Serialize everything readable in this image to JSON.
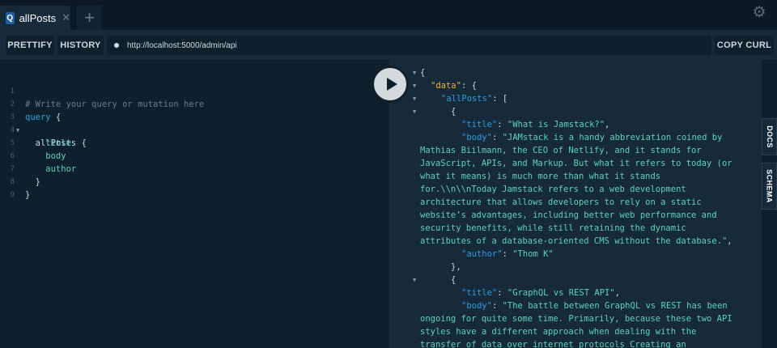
{
  "tabbar": {
    "tab": {
      "icon": "Q",
      "title": "allPosts",
      "close": "✕"
    },
    "add_icon": "plus-icon",
    "settings_icon": "gear-icon"
  },
  "toolbar": {
    "prettify_label": "PRETTIFY",
    "history_label": "HISTORY",
    "url": "http://localhost:5000/admin/api",
    "copy_curl_label": "COPY CURL"
  },
  "editor": {
    "lines": [
      {
        "num": "1",
        "text": "# Write your query or mutation here"
      },
      {
        "num": "2",
        "text": "query {"
      },
      {
        "num": "3",
        "text": "  allPosts {"
      },
      {
        "num": "4",
        "text": "    title"
      },
      {
        "num": "5",
        "text": "    body"
      },
      {
        "num": "6",
        "text": "    author"
      },
      {
        "num": "7",
        "text": "  }"
      },
      {
        "num": "8",
        "text": "}"
      },
      {
        "num": "9",
        "text": ""
      }
    ]
  },
  "result": {
    "data_key": "\"data\"",
    "allposts_key": "\"allPosts\"",
    "post1": {
      "title": "\"What is Jamstack?\"",
      "body_lines": [
        "\"JAMstack is a handy abbreviation coined by",
        "Mathias Biilmann, the CEO of Netlify, and it stands for",
        "JavaScript, APIs, and Markup. But what it refers to today (or",
        "what it means) is much more than what it stands",
        "for.\\\\n\\\\nToday Jamstack refers to a web development",
        "architecture that allows developers to rely on a static",
        "website’s advantages, including better web performance and",
        "security benefits, while still retaining the dynamic",
        "attributes of a database-oriented CMS without the database.\""
      ],
      "author": "\"Thom K\""
    },
    "post2": {
      "title": "\"GraphQL vs REST API\"",
      "body_lines": [
        "\"The battle between GraphQL vs REST has been",
        "ongoing for quite some time. Primarily, because these two API",
        "styles have a different approach when dealing with the",
        "transfer of data over internet protocols Creating an"
      ]
    }
  },
  "side": {
    "docs_label": "DOCS",
    "schema_label": "SCHEMA"
  }
}
